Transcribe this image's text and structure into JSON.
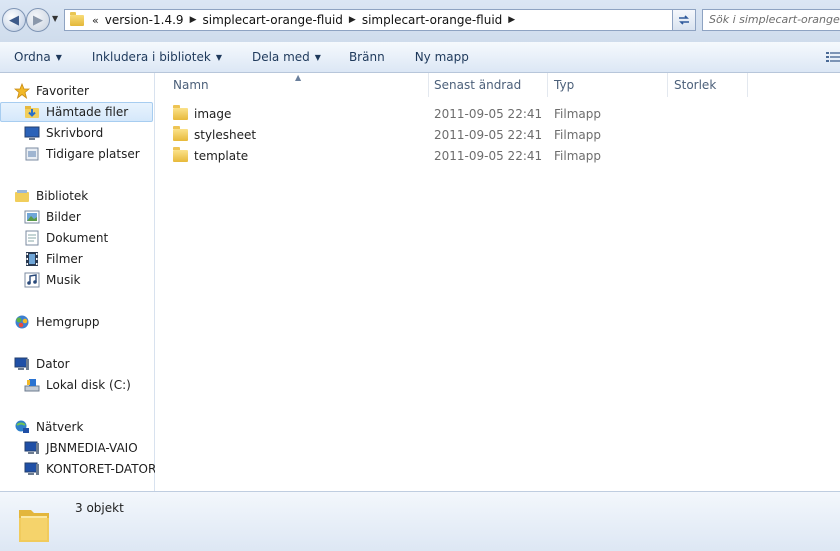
{
  "address": {
    "recent_glyph": "«",
    "breadcrumbs": [
      "version-1.4.9",
      "simplecart-orange-fluid",
      "simplecart-orange-fluid"
    ],
    "search_placeholder": "Sök i simplecart-orange-fluid"
  },
  "toolbar": {
    "organize": "Ordna",
    "include_library": "Inkludera i bibliotek",
    "share_with": "Dela med",
    "burn": "Bränn",
    "new_folder": "Ny mapp"
  },
  "nav": {
    "favorites": "Favoriter",
    "downloads": "Hämtade filer",
    "desktop": "Skrivbord",
    "recent_places": "Tidigare platser",
    "libraries": "Bibliotek",
    "pictures": "Bilder",
    "documents": "Dokument",
    "videos": "Filmer",
    "music": "Musik",
    "homegroup": "Hemgrupp",
    "computer": "Dator",
    "local_disk": "Lokal disk (C:)",
    "network": "Nätverk",
    "net_pc1": "JBNMEDIA-VAIO",
    "net_pc2": "KONTORET-DATOR"
  },
  "columns": {
    "name": "Namn",
    "modified": "Senast ändrad",
    "type": "Typ",
    "size": "Storlek"
  },
  "files": [
    {
      "name": "image",
      "modified": "2011-09-05 22:41",
      "type": "Filmapp"
    },
    {
      "name": "stylesheet",
      "modified": "2011-09-05 22:41",
      "type": "Filmapp"
    },
    {
      "name": "template",
      "modified": "2011-09-05 22:41",
      "type": "Filmapp"
    }
  ],
  "status": {
    "count": "3 objekt"
  },
  "colors": {
    "accent": "#1e395b",
    "selection": "#d5e8fb"
  }
}
